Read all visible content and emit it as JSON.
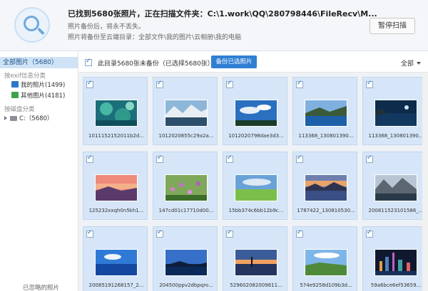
{
  "header": {
    "title": "已找到5680张照片，正在扫描文件夹：C:\\1.work\\QQ\\280798446\\FileRecv\\M...",
    "sub1": "照片备份后，将永不丢失。",
    "sub2": "照片将备份至云端目录：全部文件\\我的图片\\云相册\\我的电脑",
    "pause_label": "暂停扫描"
  },
  "sidebar": {
    "all_photos": "全部图片（5680）",
    "exif_category": "按exif信息分类",
    "my_photos": "我的照片(1499)",
    "other_photos": "其他图片(4181)",
    "disk_category": "按磁盘分类",
    "drive": "C:（5680）",
    "ignored": "已忽略的照片"
  },
  "toolbar": {
    "status": "此目录5680张未备份（已选择5680张）",
    "backup_label": "备份已选照片",
    "filter_label": "全部"
  },
  "photos": [
    {
      "name": "1011152152011b2d...",
      "scene": "coral"
    },
    {
      "name": "1012020855c29a2a...",
      "scene": "snowlake"
    },
    {
      "name": "1012020798dae3d3...",
      "scene": "sky"
    },
    {
      "name": "113368_130801390...",
      "scene": "bay"
    },
    {
      "name": "113368_130801390...",
      "scene": "cliff"
    },
    {
      "name": "125232xxqh0n5kh1...",
      "scene": "sunset"
    },
    {
      "name": "147cd01c17710d00...",
      "scene": "flowers"
    },
    {
      "name": "15bb374c6bb12b9c...",
      "scene": "field"
    },
    {
      "name": "1787422_130810530...",
      "scene": "lake"
    },
    {
      "name": "200811523101586_...",
      "scene": "fjord"
    },
    {
      "name": "20085191268157_2...",
      "scene": "ocean"
    },
    {
      "name": "204500ppv2dbpqro...",
      "scene": "hills"
    },
    {
      "name": "529602082009611...",
      "scene": "dusk"
    },
    {
      "name": "574e9258d109b3d...",
      "scene": "meadow"
    },
    {
      "name": "59a6bce6ef53659...",
      "scene": "city"
    }
  ],
  "colors": {
    "accent": "#2f7fd3",
    "selected_cell": "#d6e6f8",
    "sidebar_active": "#cfe3f7"
  }
}
